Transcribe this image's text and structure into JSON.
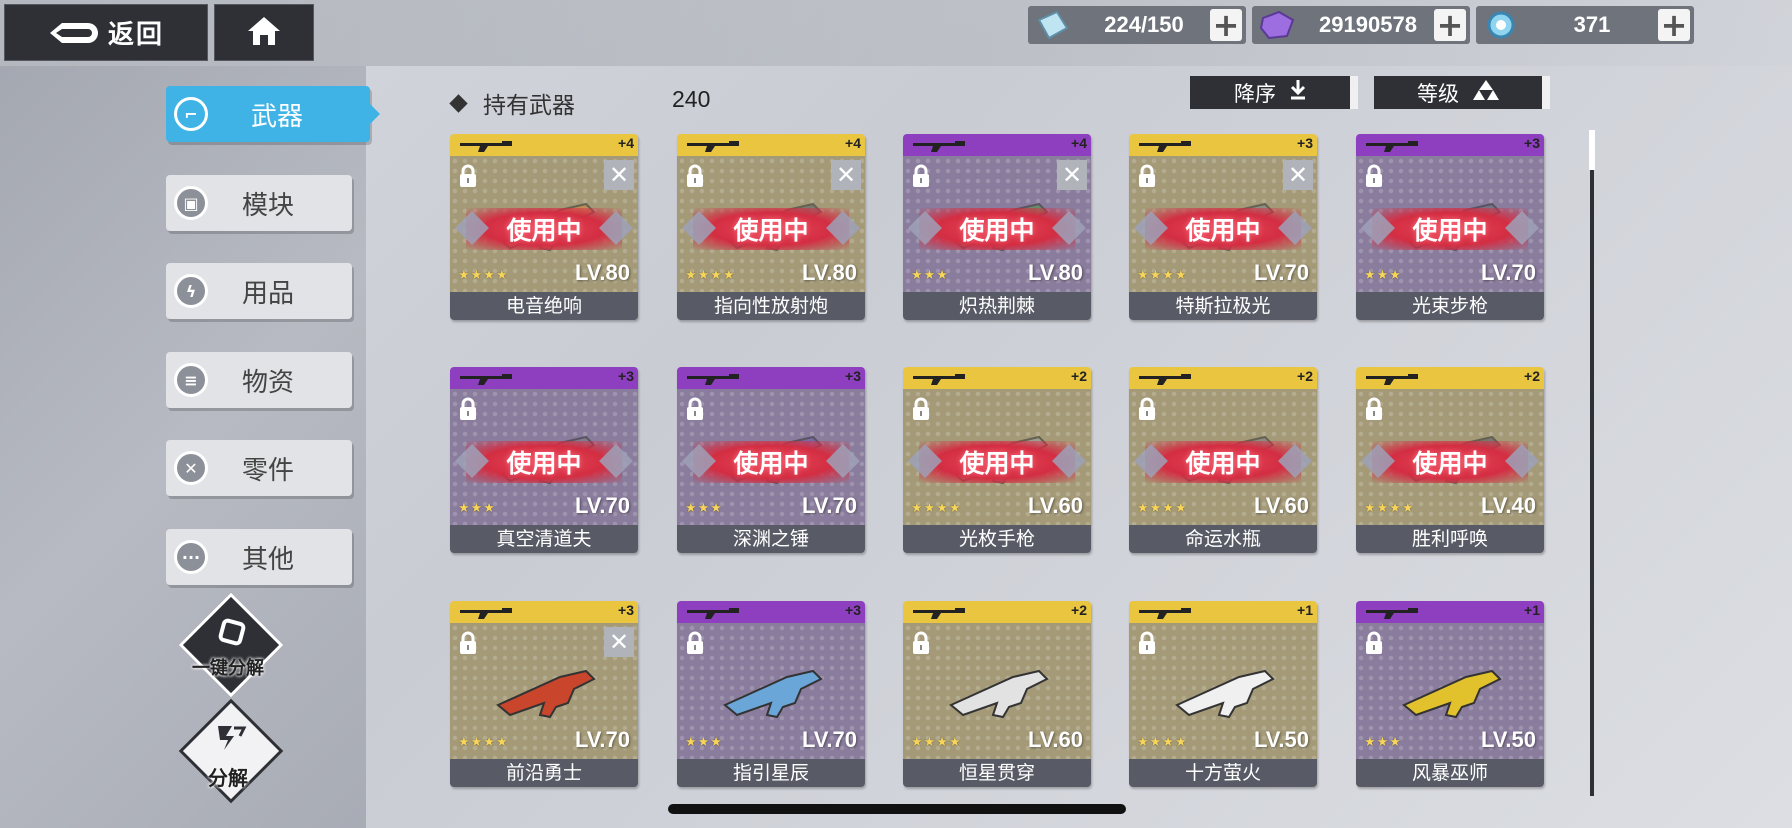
{
  "topbar": {
    "back_label": "返回",
    "resources": [
      {
        "icon": "ticket-icon",
        "value": "224/150"
      },
      {
        "icon": "purple-crystal-icon",
        "value": "29190578"
      },
      {
        "icon": "blue-orb-icon",
        "value": "371"
      }
    ]
  },
  "sidebar": {
    "items": [
      {
        "label": "武器",
        "icon": "gun-icon",
        "active": true
      },
      {
        "label": "模块",
        "icon": "module-icon",
        "active": false
      },
      {
        "label": "用品",
        "icon": "lightning-icon",
        "active": false
      },
      {
        "label": "物资",
        "icon": "supply-icon",
        "active": false
      },
      {
        "label": "零件",
        "icon": "parts-icon",
        "active": false
      },
      {
        "label": "其他",
        "icon": "more-icon",
        "active": false
      }
    ],
    "quick_dismantle_label": "一键分解",
    "dismantle_label": "分解"
  },
  "header": {
    "owned_label": "持有武器",
    "owned_count": "240",
    "sort_order_label": "降序",
    "sort_by_label": "等级"
  },
  "weapons": [
    {
      "name": "电音绝响",
      "level": "LV.80",
      "rank": "+4",
      "stars": "★★★★",
      "rarity": "gold",
      "in_use": true,
      "in_use_label": "使用中",
      "wrench": true
    },
    {
      "name": "指向性放射炮",
      "level": "LV.80",
      "rank": "+4",
      "stars": "★★★★",
      "rarity": "gold",
      "in_use": true,
      "in_use_label": "使用中",
      "wrench": true
    },
    {
      "name": "炽热荆棘",
      "level": "LV.80",
      "rank": "+4",
      "stars": "★★★",
      "rarity": "purple",
      "in_use": true,
      "in_use_label": "使用中",
      "wrench": true
    },
    {
      "name": "特斯拉极光",
      "level": "LV.70",
      "rank": "+3",
      "stars": "★★★★",
      "rarity": "gold",
      "in_use": true,
      "in_use_label": "使用中",
      "wrench": true
    },
    {
      "name": "光束步枪",
      "level": "LV.70",
      "rank": "+3",
      "stars": "★★★",
      "rarity": "purple",
      "in_use": true,
      "in_use_label": "使用中",
      "wrench": false
    },
    {
      "name": "真空清道夫",
      "level": "LV.70",
      "rank": "+3",
      "stars": "★★★",
      "rarity": "purple",
      "in_use": true,
      "in_use_label": "使用中",
      "wrench": false
    },
    {
      "name": "深渊之锤",
      "level": "LV.70",
      "rank": "+3",
      "stars": "★★★",
      "rarity": "purple",
      "in_use": true,
      "in_use_label": "使用中",
      "wrench": false
    },
    {
      "name": "光枚手枪",
      "level": "LV.60",
      "rank": "+2",
      "stars": "★★★★",
      "rarity": "gold",
      "in_use": true,
      "in_use_label": "使用中",
      "wrench": false
    },
    {
      "name": "命运水瓶",
      "level": "LV.60",
      "rank": "+2",
      "stars": "★★★★",
      "rarity": "gold",
      "in_use": true,
      "in_use_label": "使用中",
      "wrench": false
    },
    {
      "name": "胜利呼唤",
      "level": "LV.40",
      "rank": "+2",
      "stars": "★★★★",
      "rarity": "gold",
      "in_use": true,
      "in_use_label": "使用中",
      "wrench": false
    },
    {
      "name": "前沿勇士",
      "level": "LV.70",
      "rank": "+3",
      "stars": "★★★★",
      "rarity": "gold",
      "in_use": false,
      "in_use_label": "",
      "wrench": true
    },
    {
      "name": "指引星辰",
      "level": "LV.70",
      "rank": "+3",
      "stars": "★★★",
      "rarity": "purple",
      "in_use": false,
      "in_use_label": "",
      "wrench": false
    },
    {
      "name": "恒星贯穿",
      "level": "LV.60",
      "rank": "+2",
      "stars": "★★★★",
      "rarity": "gold",
      "in_use": false,
      "in_use_label": "",
      "wrench": false
    },
    {
      "name": "十方萤火",
      "level": "LV.50",
      "rank": "+1",
      "stars": "★★★★",
      "rarity": "gold",
      "in_use": false,
      "in_use_label": "",
      "wrench": false
    },
    {
      "name": "风暴巫师",
      "level": "LV.50",
      "rank": "+1",
      "stars": "★★★",
      "rarity": "purple",
      "in_use": false,
      "in_use_label": "",
      "wrench": false
    }
  ]
}
